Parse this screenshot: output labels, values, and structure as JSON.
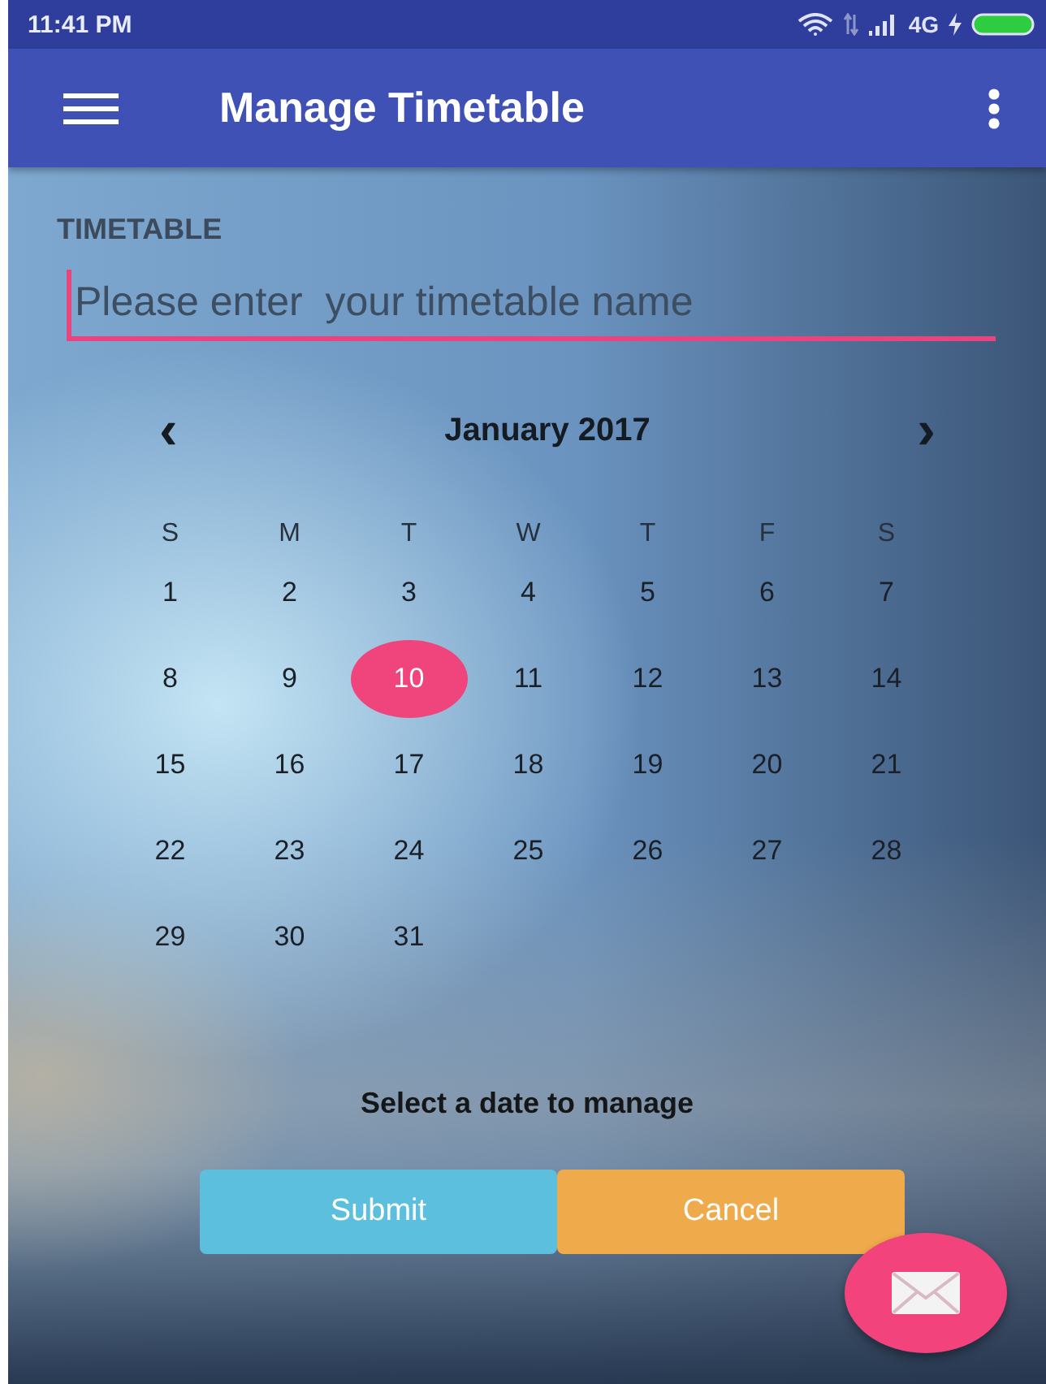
{
  "status_bar": {
    "time": "11:41 PM",
    "network": "4G"
  },
  "app_bar": {
    "title": "Manage Timetable"
  },
  "form": {
    "label": "TIMETABLE",
    "placeholder": "Please enter  your timetable name"
  },
  "calendar": {
    "month": "January 2017",
    "prev": "‹",
    "next": "›",
    "weekdays": [
      "S",
      "M",
      "T",
      "W",
      "T",
      "F",
      "S"
    ],
    "weeks": [
      [
        {
          "day": "1",
          "selected": false
        },
        {
          "day": "2",
          "selected": false
        },
        {
          "day": "3",
          "selected": false
        },
        {
          "day": "4",
          "selected": false
        },
        {
          "day": "5",
          "selected": false
        },
        {
          "day": "6",
          "selected": false
        },
        {
          "day": "7",
          "selected": false
        }
      ],
      [
        {
          "day": "8",
          "selected": false
        },
        {
          "day": "9",
          "selected": false
        },
        {
          "day": "10",
          "selected": true
        },
        {
          "day": "11",
          "selected": false
        },
        {
          "day": "12",
          "selected": false
        },
        {
          "day": "13",
          "selected": false
        },
        {
          "day": "14",
          "selected": false
        }
      ],
      [
        {
          "day": "15",
          "selected": false
        },
        {
          "day": "16",
          "selected": false
        },
        {
          "day": "17",
          "selected": false
        },
        {
          "day": "18",
          "selected": false
        },
        {
          "day": "19",
          "selected": false
        },
        {
          "day": "20",
          "selected": false
        },
        {
          "day": "21",
          "selected": false
        }
      ],
      [
        {
          "day": "22",
          "selected": false
        },
        {
          "day": "23",
          "selected": false
        },
        {
          "day": "24",
          "selected": false
        },
        {
          "day": "25",
          "selected": false
        },
        {
          "day": "26",
          "selected": false
        },
        {
          "day": "27",
          "selected": false
        },
        {
          "day": "28",
          "selected": false
        }
      ],
      [
        {
          "day": "29",
          "selected": false
        },
        {
          "day": "30",
          "selected": false
        },
        {
          "day": "31",
          "selected": false
        }
      ]
    ]
  },
  "hint": "Select a date to manage",
  "buttons": [
    {
      "label": "Submit",
      "kind": "submit"
    },
    {
      "label": "Cancel",
      "kind": "cancel"
    }
  ]
}
